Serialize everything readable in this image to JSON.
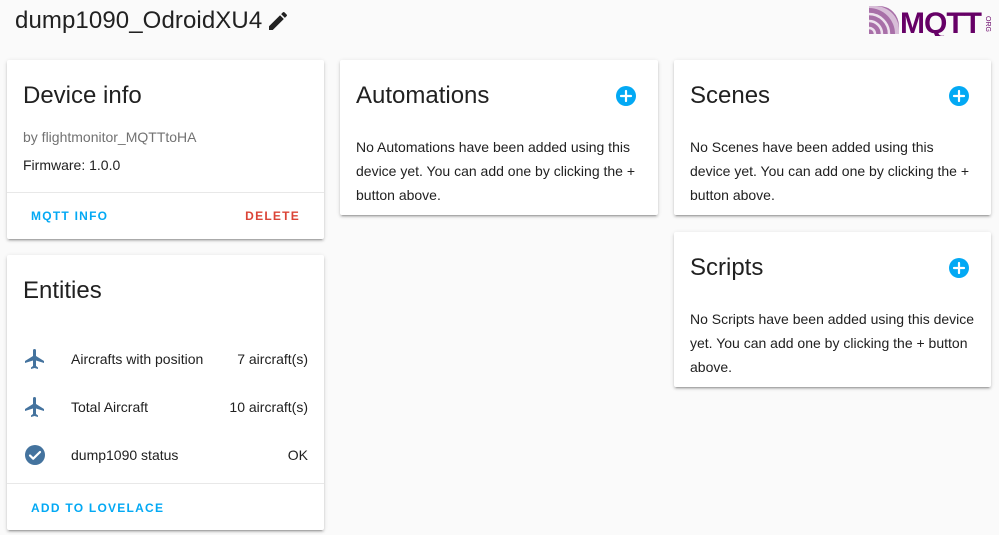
{
  "header": {
    "device_name": "dump1090_OdroidXU4",
    "edit_icon": "pencil-icon",
    "logo_text": "MQTT",
    "logo_suffix": "ORG"
  },
  "device_info": {
    "title": "Device info",
    "by_line": "by flightmonitor_MQTTtoHA",
    "firmware": "Firmware: 1.0.0",
    "mqtt_info_label": "MQTT INFO",
    "delete_label": "DELETE"
  },
  "entities": {
    "title": "Entities",
    "items": [
      {
        "icon": "airplane-icon",
        "name": "Aircrafts with position",
        "state": "7 aircraft(s)"
      },
      {
        "icon": "airplane-icon",
        "name": "Total Aircraft",
        "state": "10 aircraft(s)"
      },
      {
        "icon": "check-circle-icon",
        "name": "dump1090 status",
        "state": "OK"
      }
    ],
    "add_to_lovelace_label": "ADD TO LOVELACE"
  },
  "automations": {
    "title": "Automations",
    "text": "No Automations have been added using this device yet. You can add one by clicking the + button above."
  },
  "scenes": {
    "title": "Scenes",
    "text": "No Scenes have been added using this device yet. You can add one by clicking the + button above."
  },
  "scripts": {
    "title": "Scripts",
    "text": "No Scripts have been added using this device yet. You can add one by clicking the + button above."
  },
  "colors": {
    "accent": "#03a9f4",
    "danger": "#db4437",
    "entity_icon": "#44739e",
    "logo": "#660066"
  }
}
